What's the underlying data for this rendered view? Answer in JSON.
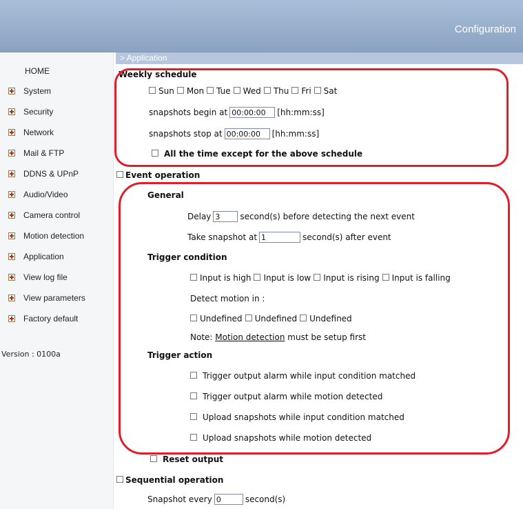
{
  "header": {
    "title": "Configuration"
  },
  "sidebar": {
    "home": "HOME",
    "items": [
      {
        "label": "System"
      },
      {
        "label": "Security"
      },
      {
        "label": "Network"
      },
      {
        "label": "Mail & FTP"
      },
      {
        "label": "DDNS & UPnP"
      },
      {
        "label": "Audio/Video"
      },
      {
        "label": "Camera control"
      },
      {
        "label": "Motion detection"
      },
      {
        "label": "Application"
      },
      {
        "label": "View log file"
      },
      {
        "label": "View parameters"
      },
      {
        "label": "Factory default"
      }
    ],
    "version": "Version : 0100a"
  },
  "section": {
    "breadcrumb": "> Application"
  },
  "weekly": {
    "title": "Weekly schedule",
    "days": [
      "Sun",
      "Mon",
      "Tue",
      "Wed",
      "Thu",
      "Fri",
      "Sat"
    ],
    "begin_label": "snapshots begin at",
    "begin_value": "00:00:00",
    "begin_hint": "[hh:mm:ss]",
    "stop_label": "snapshots stop at",
    "stop_value": "00:00:00",
    "stop_hint": "[hh:mm:ss]",
    "except_label": "All the time except for the above schedule"
  },
  "event": {
    "title": "Event operation",
    "general_title": "General",
    "delay_label": "Delay",
    "delay_value": "3",
    "delay_suffix": "second(s) before detecting the next event",
    "snapshot_label": "Take snapshot at",
    "snapshot_value": "1",
    "snapshot_suffix": "second(s) after event",
    "trigger_condition_title": "Trigger condition",
    "inputs": [
      "Input is high",
      "Input is low",
      "Input is rising",
      "Input is falling"
    ],
    "detect_motion_label": "Detect motion in :",
    "motion_windows": [
      "Undefined",
      "Undefined",
      "Undefined"
    ],
    "note_prefix": "Note:",
    "note_link": "Motion detection",
    "note_suffix": "must be setup first",
    "trigger_action_title": "Trigger action",
    "actions": [
      "Trigger output alarm while input condition matched",
      "Trigger output alarm while motion detected",
      "Upload snapshots while input condition matched",
      "Upload snapshots while motion detected"
    ],
    "reset_output": "Reset output"
  },
  "sequential": {
    "title": "Sequential operation",
    "label": "Snapshot every",
    "value": "0",
    "suffix": "second(s)"
  },
  "colors": {
    "accent": "#8aa3c2",
    "callout": "#e11d2a"
  }
}
